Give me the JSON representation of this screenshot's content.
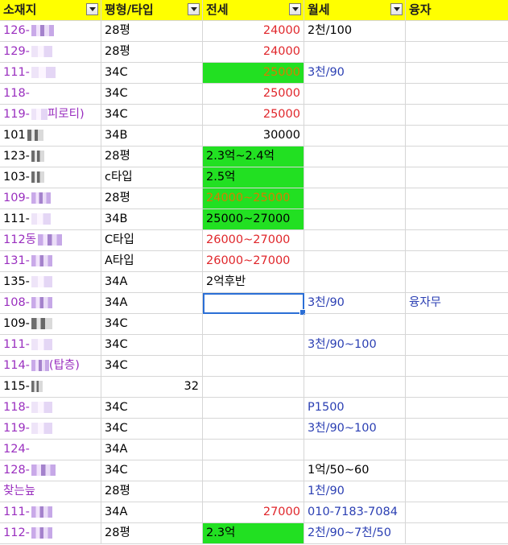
{
  "headers": [
    "소재지",
    "평형/타입",
    "전세",
    "월세",
    "융자"
  ],
  "colors": {
    "header_bg": "#ffff00",
    "highlight_green": "#22e022",
    "red": "#e0262b",
    "blue": "#2b3fb3",
    "purple": "#9a2fbf",
    "orange": "#d77d00",
    "selection": "#2b6fd6"
  },
  "rows": [
    {
      "loc": "126-",
      "typ": "28평",
      "jeonse": "24000",
      "wolse": "2천/100",
      "loan": ""
    },
    {
      "loc": "129-",
      "typ": "28평",
      "jeonse": "24000",
      "wolse": "",
      "loan": ""
    },
    {
      "loc": "111-",
      "typ": "34C",
      "jeonse": "25000",
      "wolse": "3천/90",
      "loan": ""
    },
    {
      "loc": "118-",
      "typ": "34C",
      "jeonse": "25000",
      "wolse": "",
      "loan": ""
    },
    {
      "loc": "119-",
      "loc2": "피로티)",
      "typ": "34C",
      "jeonse": "25000",
      "wolse": "",
      "loan": ""
    },
    {
      "loc": "101",
      "typ": "34B",
      "jeonse": "30000",
      "wolse": "",
      "loan": ""
    },
    {
      "loc": "123-",
      "typ": "28평",
      "jeonse": "2.3억~2.4억",
      "wolse": "",
      "loan": ""
    },
    {
      "loc": "103-",
      "typ": "c타입",
      "jeonse": "2.5억",
      "wolse": "",
      "loan": ""
    },
    {
      "loc": "109-",
      "typ": "28평",
      "jeonse": "24000~25000",
      "wolse": "",
      "loan": ""
    },
    {
      "loc": "111-",
      "typ": "34B",
      "jeonse": "25000~27000",
      "wolse": "",
      "loan": ""
    },
    {
      "loc": "112동",
      "typ": "C타입",
      "jeonse": "26000~27000",
      "wolse": "",
      "loan": ""
    },
    {
      "loc": "131-",
      "typ": "A타입",
      "jeonse": "26000~27000",
      "wolse": "",
      "loan": ""
    },
    {
      "loc": "135-",
      "typ": "34A",
      "jeonse": "2억후반",
      "wolse": "",
      "loan": ""
    },
    {
      "loc": "108-",
      "typ": "34A",
      "jeonse": "",
      "wolse": "3천/90",
      "loan": "융자무"
    },
    {
      "loc": "109-",
      "typ": "34C",
      "jeonse": "",
      "wolse": "",
      "loan": ""
    },
    {
      "loc": "111-",
      "typ": "34C",
      "jeonse": "",
      "wolse": "3천/90~100",
      "loan": ""
    },
    {
      "loc": "114-",
      "loc2": "(탑층)",
      "typ": "34C",
      "jeonse": "",
      "wolse": "",
      "loan": ""
    },
    {
      "loc": "115-",
      "typ": "32",
      "jeonse": "",
      "wolse": "",
      "loan": ""
    },
    {
      "loc": "118-",
      "typ": "34C",
      "jeonse": "",
      "wolse": "P1500",
      "loan": ""
    },
    {
      "loc": "119-",
      "typ": "34C",
      "jeonse": "",
      "wolse": "3천/90~100",
      "loan": ""
    },
    {
      "loc": "124-",
      "typ": "34A",
      "jeonse": "",
      "wolse": "",
      "loan": ""
    },
    {
      "loc": "128-",
      "typ": "34C",
      "jeonse": "",
      "wolse": "1억/50~60",
      "loan": ""
    },
    {
      "loc": "찾는늪",
      "typ": "28평",
      "jeonse": "",
      "wolse": "1천/90",
      "loan": ""
    },
    {
      "loc": "111-",
      "typ": "34A",
      "jeonse": "27000",
      "wolse": "010-7183-7084",
      "loan": ""
    },
    {
      "loc": "112-",
      "typ": "28평",
      "jeonse": "2.3억",
      "wolse": "2천/90~7천/50",
      "loan": ""
    }
  ]
}
